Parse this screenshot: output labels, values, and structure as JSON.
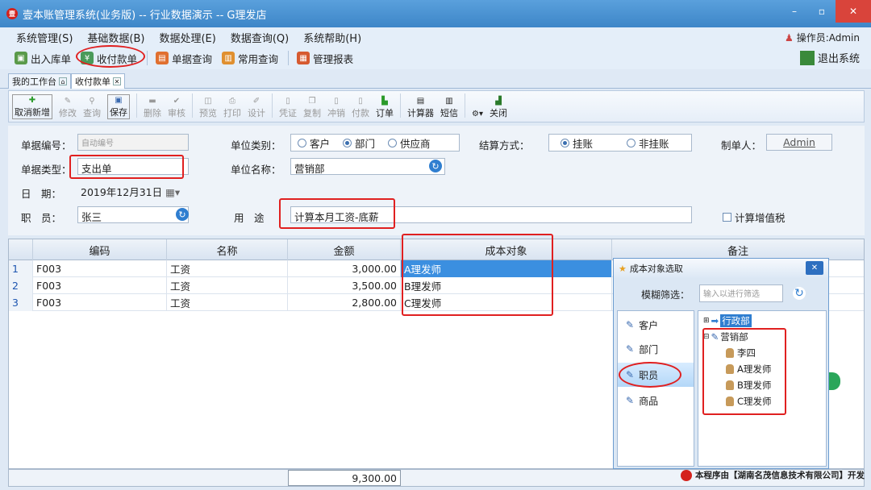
{
  "window": {
    "title": "壹本账管理系统(业务版) -- 行业数据演示 -- G理发店",
    "minimize": "–",
    "maximize": "▫",
    "close": "✕"
  },
  "menu": [
    "系统管理(S)",
    "基础数据(B)",
    "数据处理(E)",
    "数据查询(Q)",
    "系统帮助(H)"
  ],
  "operator": "操作员:Admin",
  "toolbar": {
    "items": [
      "出入库单",
      "收付款单",
      "单据查询",
      "常用查询",
      "管理报表"
    ],
    "exit": "退出系统"
  },
  "tabs": [
    "我的工作台",
    "收付款单"
  ],
  "toolbar2": [
    "取消新增",
    "修改",
    "查询",
    "保存",
    "删除",
    "审核",
    "预览",
    "打印",
    "设计",
    "凭证",
    "复制",
    "冲销",
    "付款",
    "订单",
    "计算器",
    "短信",
    "关闭"
  ],
  "form": {
    "doc_no_label": "单据编号：",
    "doc_no_value": "自动编号",
    "doc_type_label": "单据类型：",
    "doc_type_value": "支出单",
    "date_label": "日　期：",
    "date_value": "2019年12月31日",
    "staff_label": "职　员：",
    "staff_value": "张三",
    "unit_type_label": "单位类别：",
    "unit_types": [
      "客户",
      "部门",
      "供应商"
    ],
    "unit_name_label": "单位名称：",
    "unit_name_value": "营销部",
    "purpose_label": "用　途",
    "purpose_value": "计算本月工资-底薪",
    "settle_label": "结算方式：",
    "settle_opts": [
      "挂账",
      "非挂账"
    ],
    "maker_label": "制单人：",
    "maker_value": "Admin",
    "vat_label": "计算增值税"
  },
  "grid": {
    "headers": [
      "编码",
      "名称",
      "金额",
      "成本对象",
      "备注"
    ],
    "rows": [
      {
        "n": "1",
        "code": "F003",
        "name": "工资",
        "amount": "3,000.00",
        "target": "A理发师"
      },
      {
        "n": "2",
        "code": "F003",
        "name": "工资",
        "amount": "3,500.00",
        "target": "B理发师"
      },
      {
        "n": "3",
        "code": "F003",
        "name": "工资",
        "amount": "2,800.00",
        "target": "C理发师"
      }
    ],
    "total": "9,300.00"
  },
  "popup": {
    "title": "成本对象选取",
    "filter_label": "模糊筛选：",
    "filter_placeholder": "输入以进行筛选",
    "categories": [
      "客户",
      "部门",
      "职员",
      "商品"
    ],
    "tree": {
      "dept1": "行政部",
      "dept2": "营销部",
      "people": [
        "李四",
        "A理发师",
        "B理发师",
        "C理发师"
      ]
    }
  },
  "credit": "本程序由【湖南名茂信息技术有限公司】开发"
}
